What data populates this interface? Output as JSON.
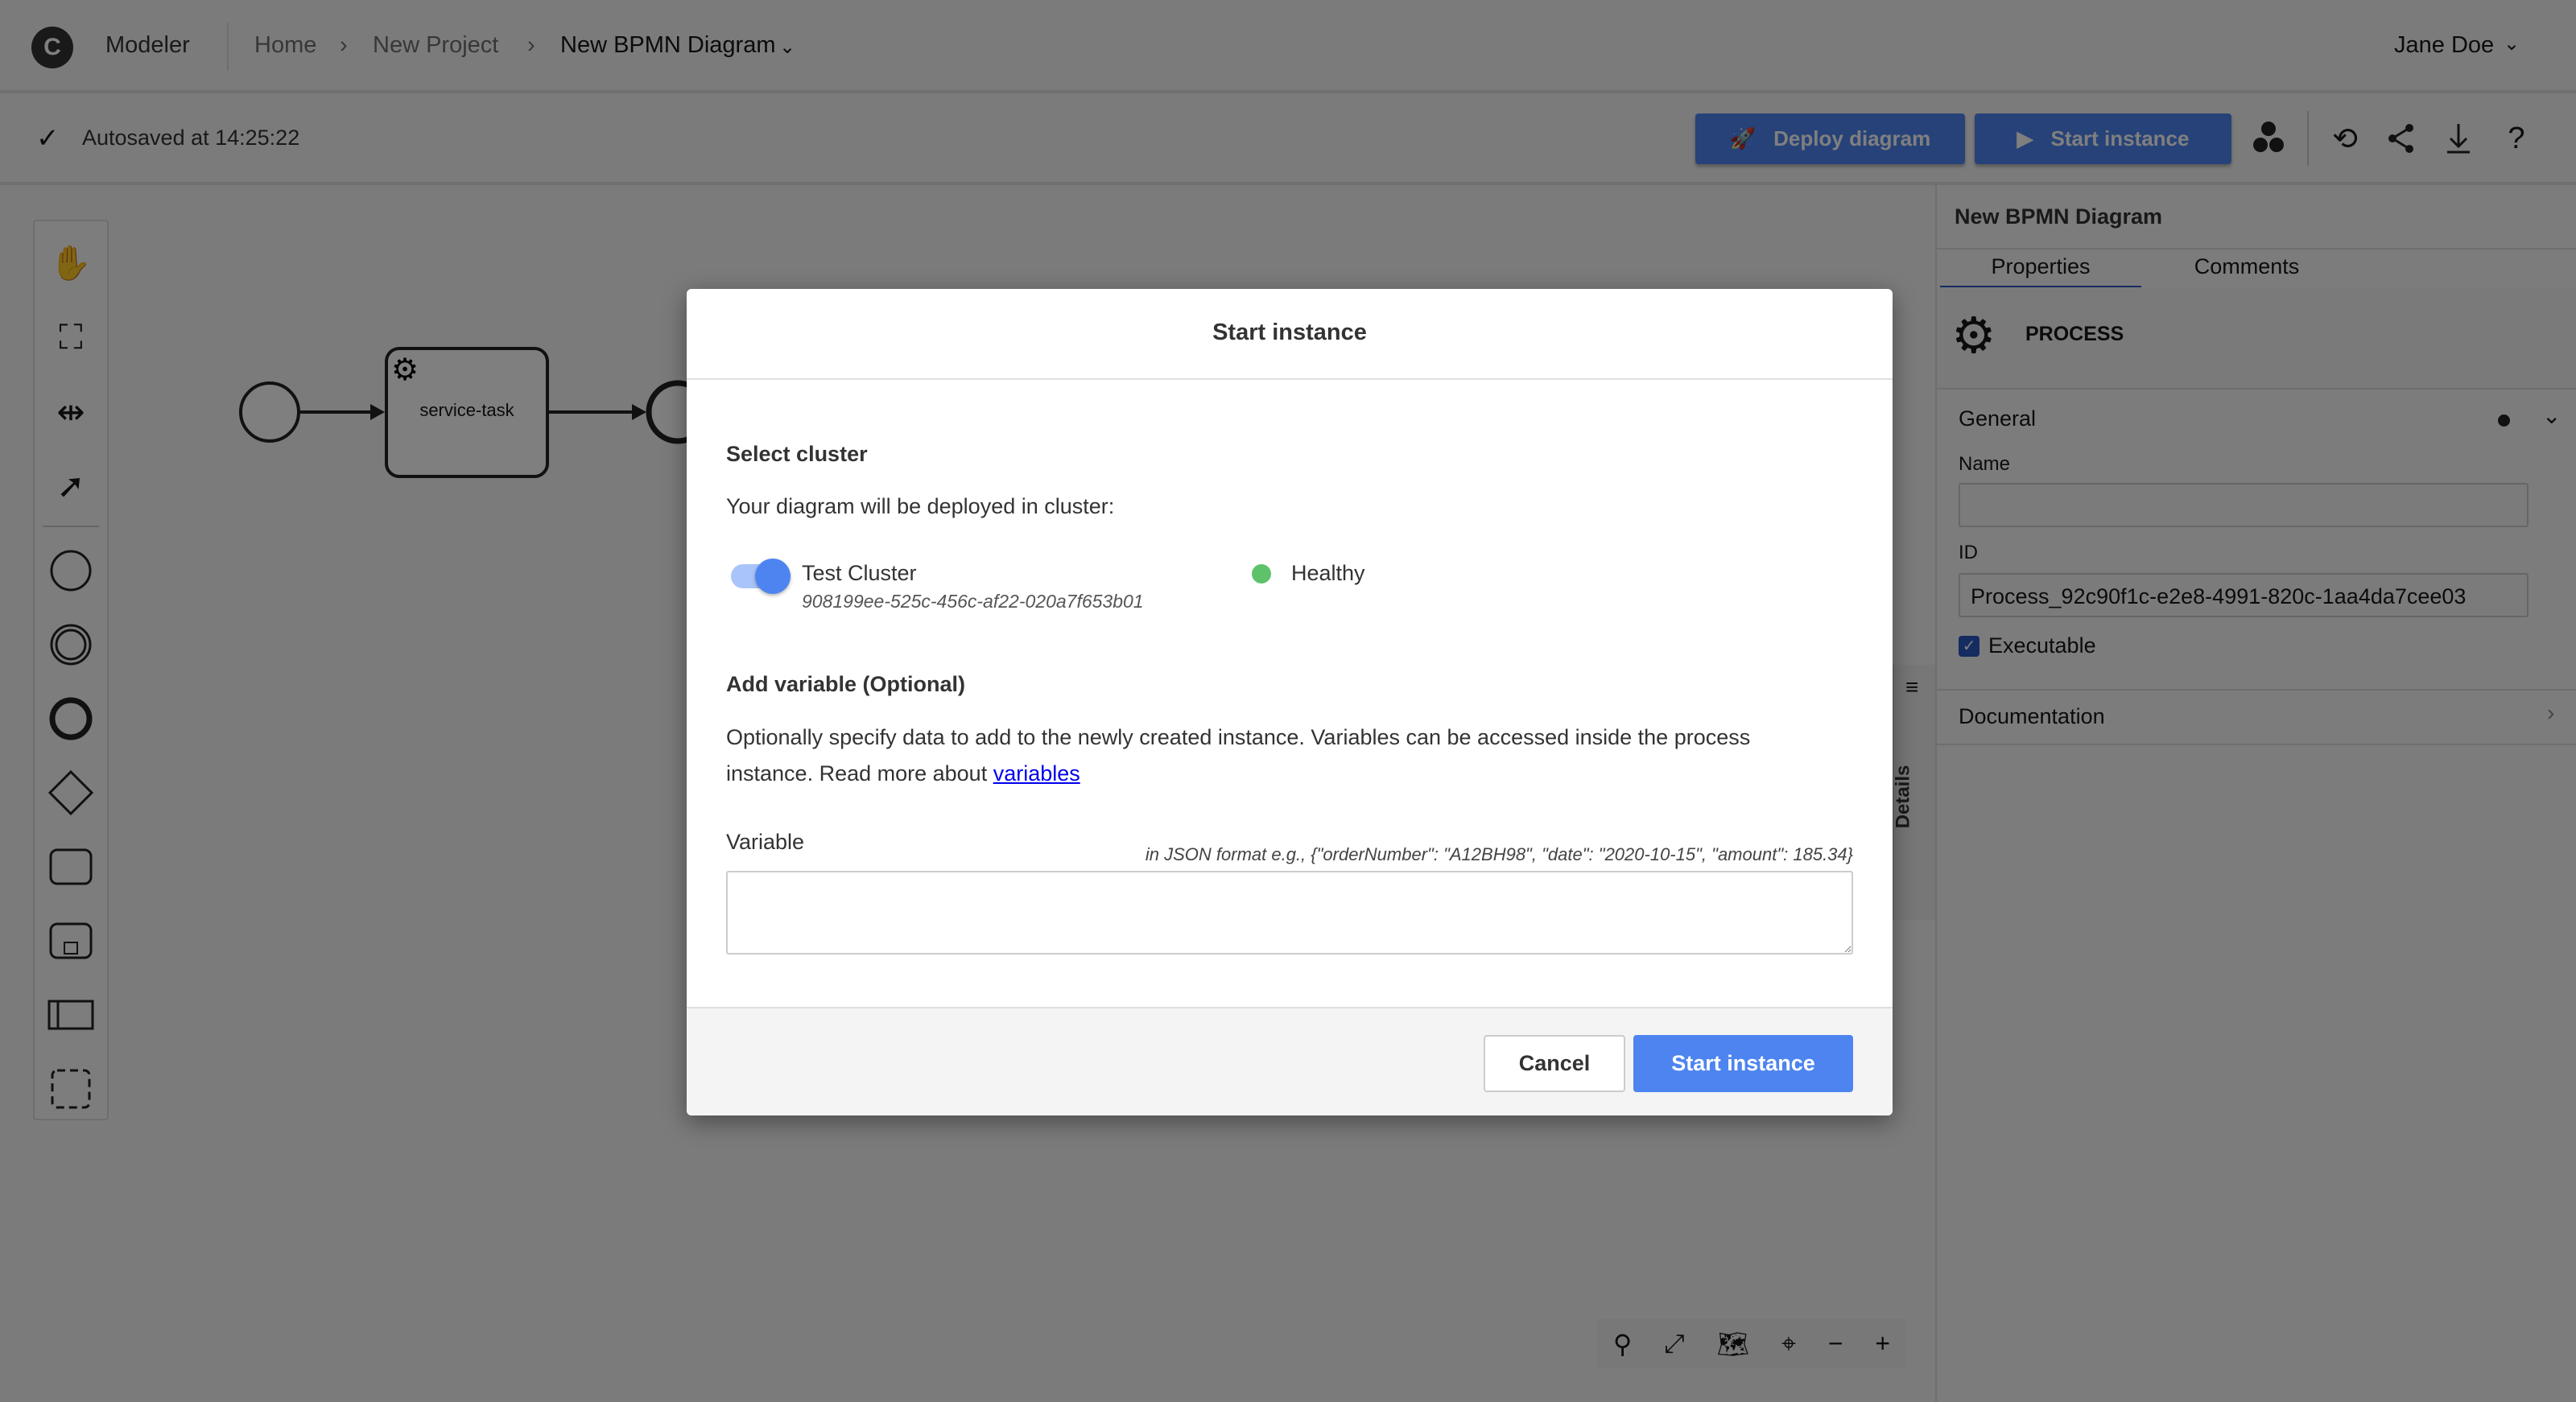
{
  "header": {
    "app_name": "Modeler",
    "breadcrumbs": [
      "Home",
      "New Project",
      "New BPMN Diagram"
    ],
    "user": "Jane Doe"
  },
  "toolbar": {
    "autosave": "Autosaved at 14:25:22",
    "deploy_label": "Deploy diagram",
    "start_label": "Start instance"
  },
  "diagram": {
    "task_label": "service-task"
  },
  "panel": {
    "title": "New BPMN Diagram",
    "tabs": [
      "Properties",
      "Comments"
    ],
    "element_type": "PROCESS",
    "general": "General",
    "name_label": "Name",
    "name_value": "",
    "id_label": "ID",
    "id_value": "Process_92c90f1c-e2e8-4991-820c-1aa4da7cee03",
    "executable_label": "Executable",
    "documentation": "Documentation",
    "details_tab": "Details"
  },
  "modal": {
    "title": "Start instance",
    "select_cluster": "Select cluster",
    "cluster_intro": "Your diagram will be deployed in cluster:",
    "cluster_name": "Test Cluster",
    "cluster_id": "908199ee-525c-456c-af22-020a7f653b01",
    "cluster_status": "Healthy",
    "add_variable": "Add variable (Optional)",
    "desc_1": "Optionally specify data to add to the newly created instance. Variables can be accessed inside the process",
    "desc_2": "instance. Read more about ",
    "desc_link": "variables",
    "variable_label": "Variable",
    "variable_hint": "in JSON format e.g., {\"orderNumber\": \"A12BH98\", \"date\": \"2020-10-15\", \"amount\": 185.34}",
    "variable_value": "",
    "cancel": "Cancel",
    "start": "Start instance"
  },
  "colors": {
    "accent": "#4d84f0",
    "healthy": "#24a148"
  }
}
